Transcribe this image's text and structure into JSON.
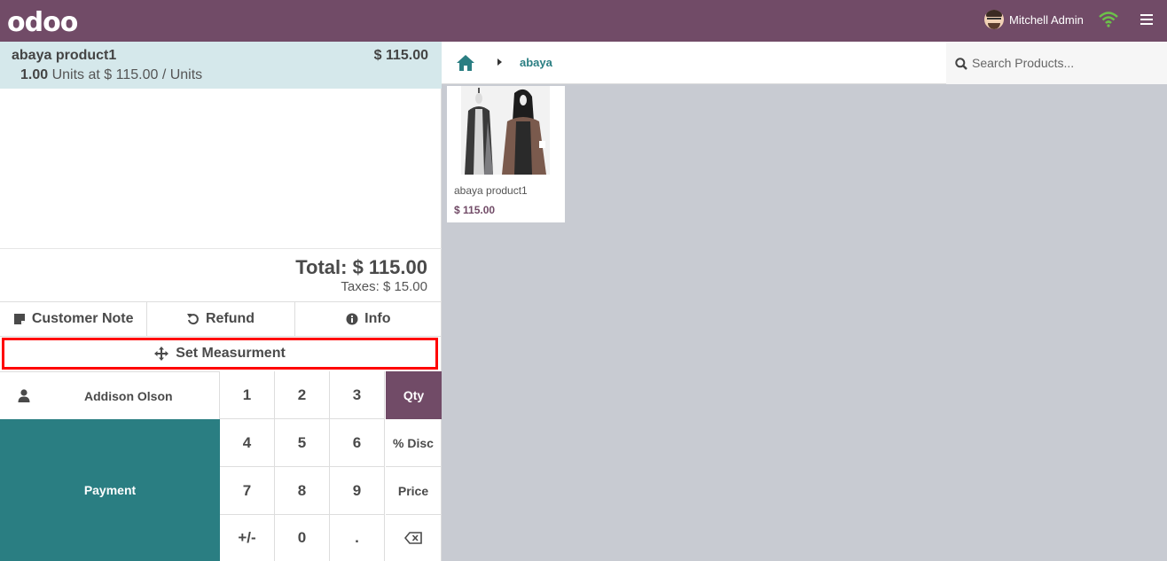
{
  "topbar": {
    "logo": "odoo",
    "user_name": "Mitchell Admin",
    "brand_color": "#714b67"
  },
  "order": {
    "lines": [
      {
        "name": "abaya product1",
        "price": "$ 115.00",
        "quantity": "1.00",
        "detail": "Units at $ 115.00 / Units"
      }
    ],
    "total": "Total: $ 115.00",
    "taxes": "Taxes: $ 15.00"
  },
  "controls": {
    "customer_note": "Customer Note",
    "refund": "Refund",
    "info": "Info",
    "set_measurement": "Set Measurment"
  },
  "customer": {
    "name": "Addison Olson"
  },
  "payment": {
    "label": "Payment",
    "color": "#2a7e82"
  },
  "keypad": {
    "keys": [
      "1",
      "2",
      "3",
      "4",
      "5",
      "6",
      "7",
      "8",
      "9",
      "+/-",
      "0",
      "."
    ],
    "modes": [
      "Qty",
      "% Disc",
      "Price"
    ],
    "active_mode": "Qty",
    "backspace_icon": "backspace-icon"
  },
  "products": {
    "breadcrumb": "abaya",
    "search_placeholder": "Search Products...",
    "items": [
      {
        "name": "abaya product1",
        "price": "$ 115.00"
      }
    ]
  }
}
